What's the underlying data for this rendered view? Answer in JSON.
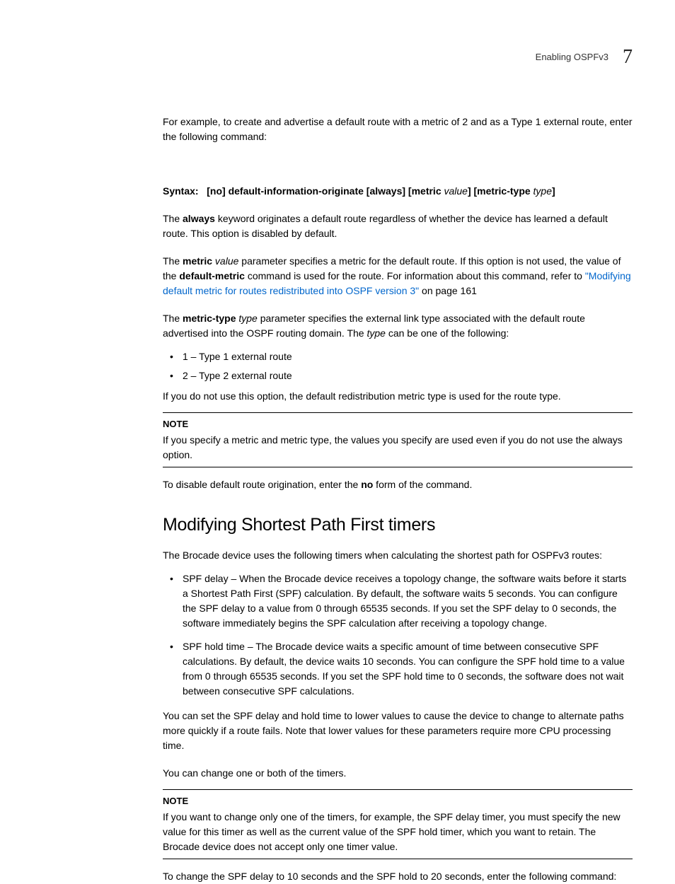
{
  "header": {
    "section": "Enabling OSPFv3",
    "chapter": "7"
  },
  "intro_para": "For example, to create and advertise a default route with a metric of 2 and as a Type 1 external route, enter the following command:",
  "syntax": {
    "label": "Syntax:",
    "body1": "[no] default-information-originate [always] [metric ",
    "value": "value",
    "body2": "] [metric-type ",
    "type": "type",
    "body3": "]"
  },
  "always_para": {
    "pre": "The ",
    "kw": "always",
    "post": " keyword originates a default route regardless of whether the device has learned a default route. This option is disabled by default."
  },
  "metric_para": {
    "pre": "The ",
    "kw": "metric",
    "val": " value",
    "mid": " parameter specifies a metric for the default route. If this option is not used, the value of the ",
    "kw2": "default-metric",
    "mid2": " command is used for the route. For information about this command, refer to ",
    "link": "\"Modifying default metric for routes redistributed into OSPF version 3\"",
    "post": " on page 161"
  },
  "metrictype_para": {
    "pre": "The ",
    "kw": "metric-type",
    "val": " type",
    "mid": " parameter specifies the external link type associated with the default route advertised into the OSPF routing domain. The ",
    "val2": "type",
    "post": " can be one of the following:"
  },
  "types": {
    "t1": "1 – Type 1 external route",
    "t2": "2 – Type 2 external route"
  },
  "default_redist": "If you do not use this option, the default redistribution metric type is used for the route type.",
  "note1": {
    "title": "NOTE",
    "body": "If you specify a metric and metric type, the values you specify are used even if you do not use the always option."
  },
  "disable_para": {
    "pre": "To disable default route origination, enter the ",
    "kw": "no",
    "post": " form of the command."
  },
  "h2": "Modifying Shortest Path First timers",
  "h2_intro": "The Brocade device uses the following timers when calculating the shortest path for OSPFv3 routes:",
  "spf": {
    "delay": "SPF delay – When the Brocade device receives a topology change, the software waits before it starts a Shortest Path First (SPF) calculation. By default, the software waits 5 seconds. You can configure the SPF delay to a value from 0 through 65535 seconds. If you set the SPF delay to 0 seconds, the software immediately begins the SPF calculation after receiving a topology change.",
    "hold": "SPF hold time – The Brocade device waits a specific amount of time between consecutive SPF calculations. By default, the device waits 10 seconds. You can configure the SPF hold time to a value from 0 through 65535 seconds. If you set the SPF hold time to 0 seconds, the software does not wait between consecutive SPF calculations."
  },
  "spf_lower": "You can set the SPF delay and hold time to lower values to cause the device to change to alternate paths more quickly if a route fails. Note that lower values for these parameters require more CPU processing time.",
  "change_one_or_both": "You can change one or both of the timers.",
  "note2": {
    "title": "NOTE",
    "body": "If you want to change only one of the timers, for example, the SPF delay timer, you must specify the new value for this timer as well as the current value of the SPF hold timer, which you want to retain. The Brocade device does not accept only one timer value."
  },
  "change_cmd": "To change the SPF delay to 10 seconds and the SPF hold to 20 seconds, enter the following command:"
}
